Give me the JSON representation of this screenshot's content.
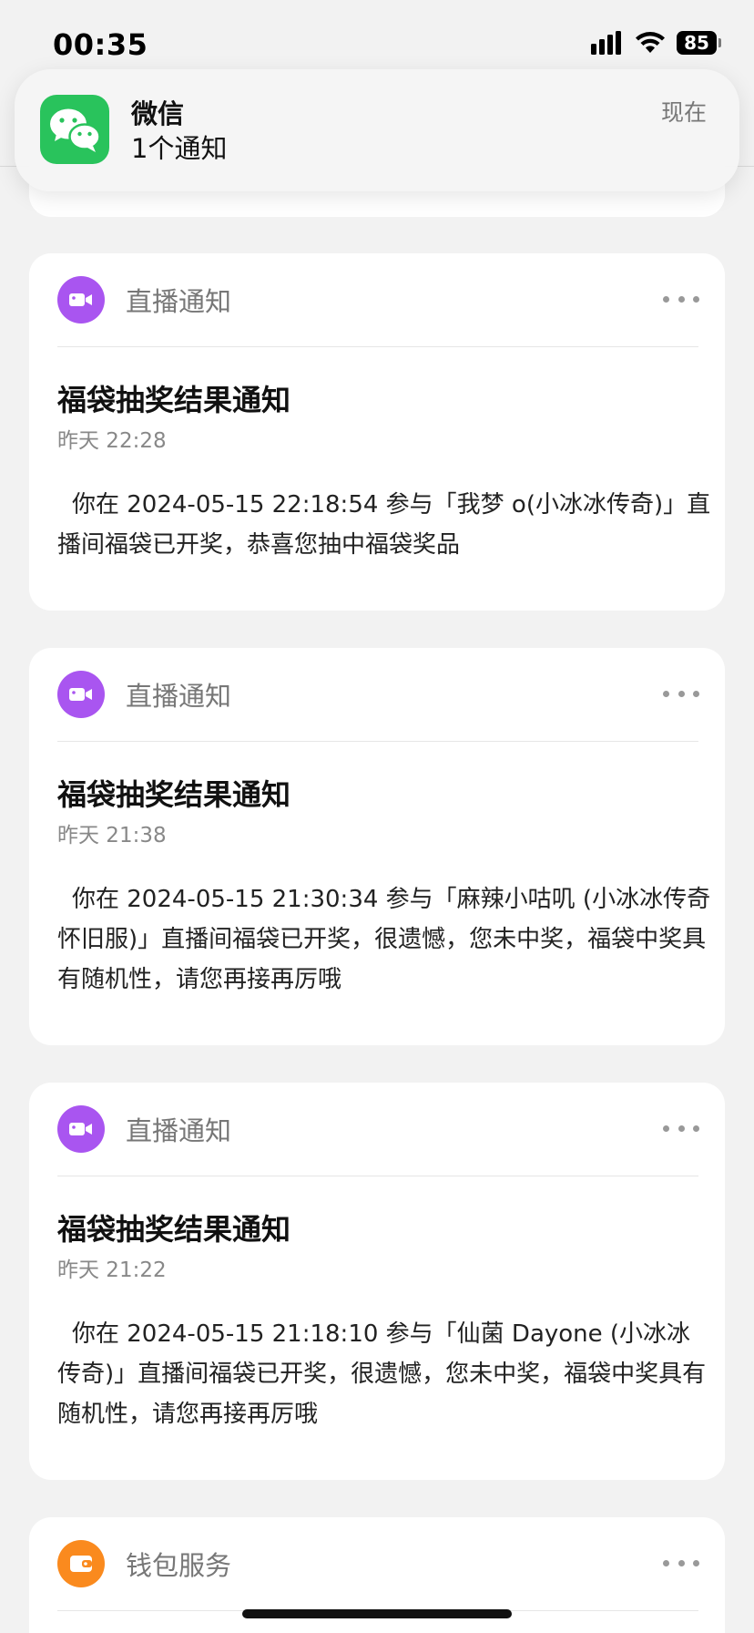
{
  "status_bar": {
    "time": "00:35",
    "battery": "85"
  },
  "banner": {
    "app_name": "微信",
    "message": "1个通知",
    "time": "现在",
    "icon": "wechat-icon",
    "icon_color": "#29c35c"
  },
  "cards": [
    {
      "service_name": "直播通知",
      "service_icon": "video-camera-icon",
      "icon_color": "#a955f0",
      "title": "福袋抽奖结果通知",
      "time": "昨天 22:28",
      "body": "你在 2024-05-15 22:18:54 参与「我梦 o(小冰冰传奇)」直播间福袋已开奖，恭喜您抽中福袋奖品"
    },
    {
      "service_name": "直播通知",
      "service_icon": "video-camera-icon",
      "icon_color": "#a955f0",
      "title": "福袋抽奖结果通知",
      "time": "昨天 21:38",
      "body": "你在 2024-05-15 21:30:34 参与「麻辣小咕叽 (小冰冰传奇怀旧服)」直播间福袋已开奖，很遗憾，您未中奖，福袋中奖具有随机性，请您再接再厉哦"
    },
    {
      "service_name": "直播通知",
      "service_icon": "video-camera-icon",
      "icon_color": "#a955f0",
      "title": "福袋抽奖结果通知",
      "time": "昨天 21:22",
      "body": "你在 2024-05-15 21:18:10 参与「仙菌 Dayone (小冰冰传奇)」直播间福袋已开奖，很遗憾，您未中奖，福袋中奖具有随机性，请您再接再厉哦"
    },
    {
      "service_name": "钱包服务",
      "service_icon": "wallet-icon",
      "icon_color": "#fa8a1e"
    }
  ]
}
